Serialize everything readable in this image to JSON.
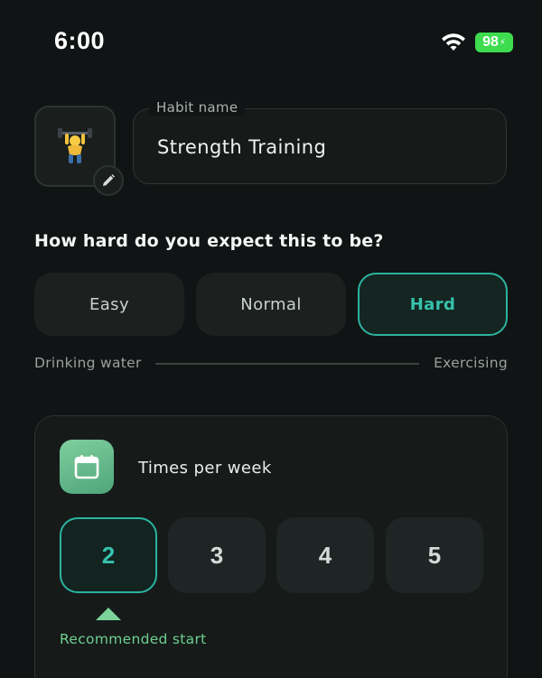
{
  "status_bar": {
    "time": "6:00",
    "battery": "98",
    "wifi_icon": "wifi-icon",
    "battery_color": "#3ddc4f"
  },
  "habit": {
    "emoji_icon": "person-lifting-weights-emoji",
    "edit_icon": "pencil-icon",
    "name_label": "Habit name",
    "name_value": "Strength Training"
  },
  "difficulty": {
    "question": "How hard do you expect this to be?",
    "options": [
      "Easy",
      "Normal",
      "Hard"
    ],
    "selected": "Hard",
    "scale_left": "Drinking water",
    "scale_right": "Exercising",
    "accent": "#2bb39f"
  },
  "frequency": {
    "icon": "calendar-icon",
    "title": "Times per week",
    "options": [
      "2",
      "3",
      "4",
      "5"
    ],
    "selected": "2",
    "recommendation": "Recommended start",
    "recommend_color": "#6fcf8f"
  }
}
